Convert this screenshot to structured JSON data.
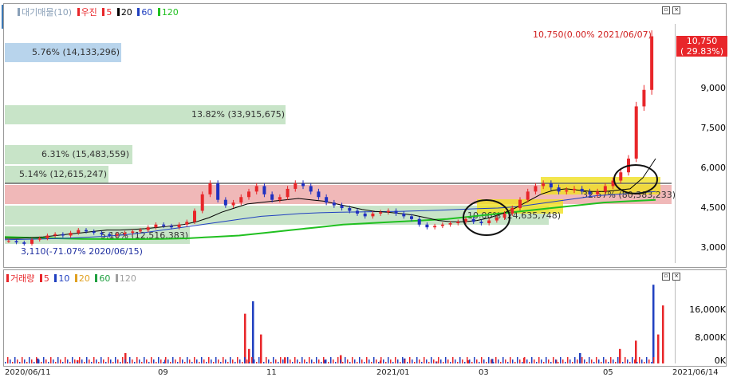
{
  "price_panel": {
    "legend": [
      {
        "label": "대기매물(10)",
        "color": "#8aa0b8"
      },
      {
        "label": "우진",
        "color": "#e8262a"
      },
      {
        "label": "5",
        "color": "#e8262a"
      },
      {
        "label": "20",
        "color": "#000000"
      },
      {
        "label": "60",
        "color": "#2040c0"
      },
      {
        "label": "120",
        "color": "#20c020"
      }
    ],
    "y_ticks": [
      "10,750",
      "9,000",
      "7,500",
      "6,000",
      "4,500",
      "3,000"
    ],
    "price_tag": {
      "value": "10,750",
      "pct": "( 29.83%)"
    },
    "high_note": "10,750(0.00% 2021/06/07)",
    "low_note": "3,110(-71.07% 2020/06/15)",
    "bands": [
      {
        "label": "5.76% (14,133,296)",
        "color": "#b8d4ec"
      },
      {
        "label": "13.82% (33,915,675)",
        "color": "#c8e4c8"
      },
      {
        "label": "6.31% (15,483,559)",
        "color": "#c8e4c8"
      },
      {
        "label": "5.14% (12,615,247)",
        "color": "#c8e4c8"
      },
      {
        "label": "32.57% (80,383,233)",
        "color": "#f0b8b8"
      },
      {
        "label": "10.06% (24,635,748)",
        "color": "#c8e4c8"
      },
      {
        "label": "5.10% (12,516,383)",
        "color": "#c8e4c8"
      }
    ],
    "icon_side_tab": "side-tab-icon"
  },
  "volume_panel": {
    "legend": [
      {
        "label": "거래량",
        "color": "#e8262a"
      },
      {
        "label": "5",
        "color": "#e8262a"
      },
      {
        "label": "10",
        "color": "#2040c0"
      },
      {
        "label": "20",
        "color": "#e0a020"
      },
      {
        "label": "60",
        "color": "#20a040"
      },
      {
        "label": "120",
        "color": "#a0a0a0"
      }
    ],
    "y_ticks": [
      "16,000K",
      "8,000K",
      "0K"
    ]
  },
  "x_axis": [
    "2020/06/11",
    "09",
    "11",
    "2021/01",
    "03",
    "05",
    "2021/06/14"
  ],
  "chart_data": {
    "type": "candlestick",
    "title": "",
    "price_ylim": [
      2500,
      11200
    ],
    "close_series": [
      3300,
      3250,
      3200,
      3350,
      3400,
      3500,
      3550,
      3500,
      3600,
      3700,
      3650,
      3600,
      3550,
      3500,
      3550,
      3600,
      3650,
      3700,
      3800,
      3900,
      3850,
      3800,
      3900,
      4000,
      4400,
      5000,
      5400,
      4800,
      4600,
      4700,
      4900,
      5100,
      5300,
      5000,
      4800,
      4900,
      5200,
      5400,
      5300,
      5100,
      4900,
      4700,
      4600,
      4500,
      4400,
      4300,
      4200,
      4300,
      4350,
      4400,
      4300,
      4200,
      4100,
      3900,
      3800,
      3850,
      3900,
      3950,
      4000,
      4100,
      4000,
      3950,
      4050,
      4150,
      4300,
      4500,
      4800,
      5100,
      5300,
      5400,
      5250,
      5100,
      5150,
      5200,
      5100,
      5000,
      5100,
      5300,
      5500,
      5800,
      6300,
      8200,
      8800,
      10750
    ],
    "ma_lines": {
      "20": [
        3400,
        3400,
        3420,
        3450,
        3500,
        3550,
        3600,
        3650,
        3700,
        3700,
        3720,
        3750,
        3800,
        3850,
        3900,
        4000,
        4150,
        4350,
        4500,
        4650,
        4700,
        4750,
        4800,
        4850,
        4800,
        4750,
        4650,
        4550,
        4450,
        4380,
        4350,
        4300,
        4250,
        4150,
        4050,
        4000,
        4000,
        4050,
        4150,
        4300,
        4500,
        4750,
        5000,
        5150,
        5200,
        5150,
        5100,
        5100,
        5150,
        5200,
        5600,
        6300
      ],
      "60": [
        3350,
        3360,
        3380,
        3400,
        3430,
        3470,
        3520,
        3600,
        3700,
        3800,
        3900,
        4000,
        4100,
        4200,
        4250,
        4300,
        4330,
        4350,
        4360,
        4370,
        4380,
        4400,
        4420,
        4450,
        4480,
        4500,
        4550,
        4650,
        4750,
        4850,
        4950,
        5000,
        5050,
        5100
      ],
      "120": [
        3450,
        3420,
        3400,
        3380,
        3370,
        3370,
        3380,
        3400,
        3450,
        3500,
        3600,
        3700,
        3800,
        3900,
        3950,
        4000,
        4050,
        4100,
        4200,
        4300,
        4400,
        4500,
        4600,
        4700,
        4750,
        4800
      ]
    },
    "volume_ylim": [
      0,
      20000
    ],
    "volume_spikes_k": [
      1200,
      800,
      2500,
      900,
      12000,
      3500,
      15000,
      7000,
      1500,
      900,
      2000,
      700,
      1200,
      500,
      800,
      1100,
      1400,
      900,
      2500,
      3500,
      5500,
      19000,
      7000,
      14000
    ]
  }
}
